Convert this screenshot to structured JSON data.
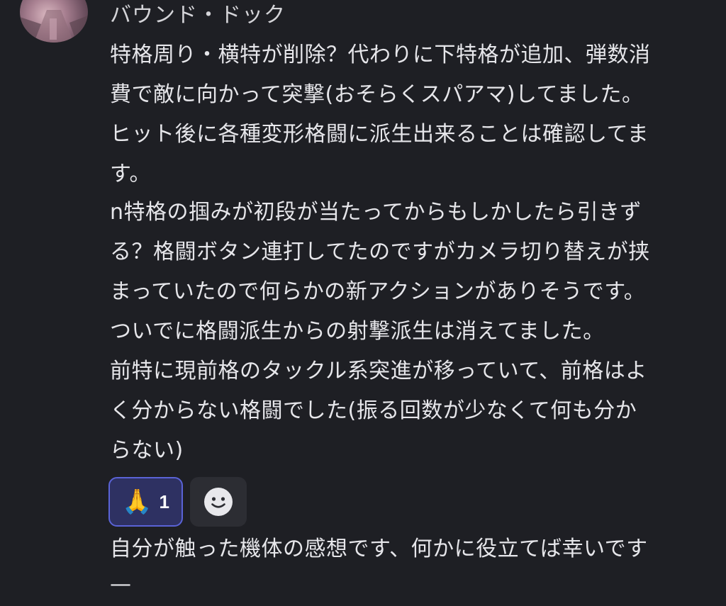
{
  "author": {
    "name": "バウンド・ドック"
  },
  "messages": [
    {
      "text": "特格周り・横特が削除？代わりに下特格が追加、弾数消\n費で敵に向かって突撃(おそらくスパアマ)してました。\nヒット後に各種変形格闘に派生出来ることは確認してま\nす。"
    },
    {
      "text": "n特格の掴みが初段が当たってからもしかしたら引きず\nる？格闘ボタン連打してたのですがカメラ切り替えが挟\nまっていたので何らかの新アクションがありそうです。\nついでに格闘派生からの射撃派生は消えてました。\n前特に現前格のタックル系突進が移っていて、前格はよ\nく分からない格闘でした(振る回数が少なくて何も分か\nらない)"
    },
    {
      "text": "自分が触った機体の感想です、何かに役立てば幸いです\n—"
    }
  ],
  "reactions": [
    {
      "emoji": "🙏",
      "icon": "folded-hands-icon",
      "count": "1",
      "active": true
    }
  ],
  "add_reaction": {
    "icon": "smiley-icon"
  },
  "colors": {
    "background": "#1e1f24",
    "text": "#e6e6ea",
    "reaction_active_bg": "#2e3162",
    "reaction_active_border": "#5a63d6",
    "reaction_add_bg": "#2c2d33"
  }
}
